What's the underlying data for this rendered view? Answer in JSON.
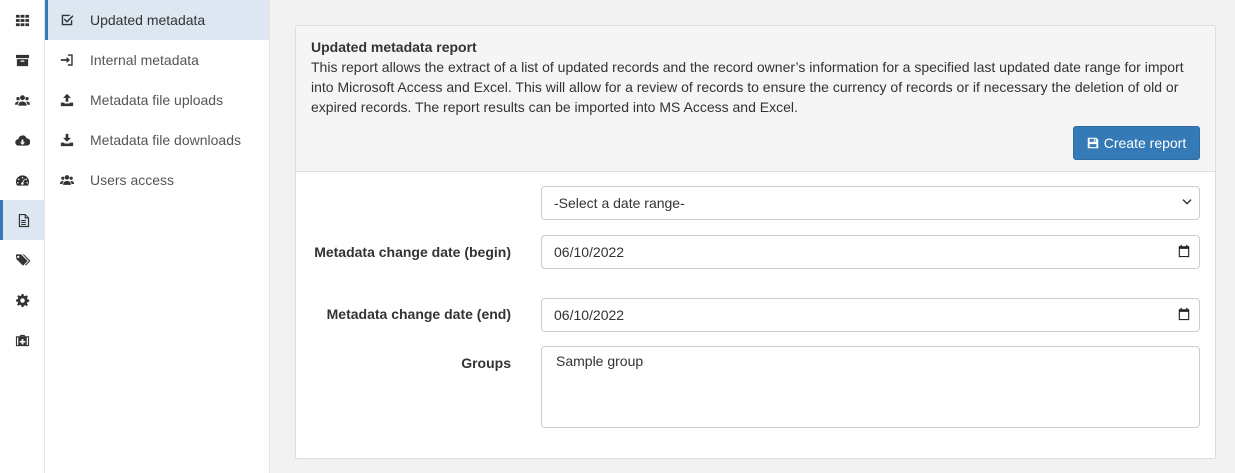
{
  "iconbar": {
    "items": [
      {
        "icon": "grid-icon",
        "active": false
      },
      {
        "icon": "archive-icon",
        "active": false
      },
      {
        "icon": "users-icon",
        "active": false
      },
      {
        "icon": "cloud-download-icon",
        "active": false
      },
      {
        "icon": "dashboard-icon",
        "active": false
      },
      {
        "icon": "file-text-icon",
        "active": true
      },
      {
        "icon": "tags-icon",
        "active": false
      },
      {
        "icon": "gear-icon",
        "active": false
      },
      {
        "icon": "medkit-icon",
        "active": false
      }
    ]
  },
  "subnav": {
    "items": [
      {
        "label": "Updated metadata",
        "icon": "check-square-icon",
        "active": true
      },
      {
        "label": "Internal metadata",
        "icon": "sign-in-icon",
        "active": false
      },
      {
        "label": "Metadata file uploads",
        "icon": "upload-icon",
        "active": false
      },
      {
        "label": "Metadata file downloads",
        "icon": "download-icon",
        "active": false
      },
      {
        "label": "Users access",
        "icon": "users-icon",
        "active": false
      }
    ]
  },
  "report": {
    "title": "Updated metadata report",
    "description": "This report allows the extract of a list of updated records and the record owner’s information for a specified last updated date range for import into Microsoft Access and Excel. This will allow for a review of records to ensure the currency of records or if necessary the deletion of old or expired records. The report results can be imported into MS Access and Excel.",
    "create_button": "Create report"
  },
  "form": {
    "date_range": {
      "value": "-Select a date range-"
    },
    "begin": {
      "label": "Metadata change date (begin)",
      "value": "06/10/2022"
    },
    "end": {
      "label": "Metadata change date (end)",
      "value": "06/10/2022"
    },
    "groups": {
      "label": "Groups",
      "value": "Sample group"
    }
  },
  "colors": {
    "accent": "#337ab7",
    "active_bg": "#dce7f2"
  }
}
